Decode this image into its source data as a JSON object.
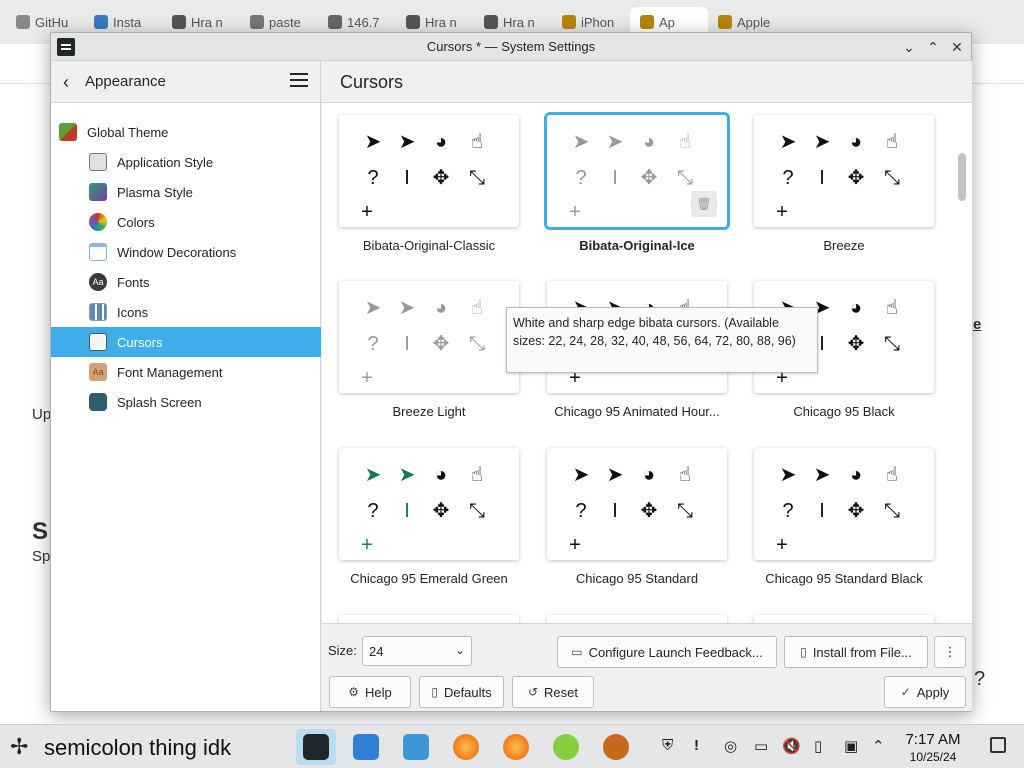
{
  "browser": {
    "tabs": [
      "GitHu",
      "Insta",
      "Hra n",
      "paste",
      "146.7",
      "Hra n",
      "Hra n",
      "iPhon",
      "Ap",
      "Apple"
    ],
    "bg_texts": [
      "Up",
      "S",
      "Sp",
      "e",
      "?"
    ]
  },
  "window": {
    "title": "Cursors * — System Settings",
    "minimize_glyph": "⌄",
    "maximize_glyph": "⌃",
    "close_glyph": "✕"
  },
  "sidebar": {
    "back_label": "Appearance",
    "back_glyph": "‹",
    "items": [
      {
        "label": "Global Theme",
        "icon": "global-theme-icon",
        "color": "#5a9e3a"
      },
      {
        "label": "Application Style",
        "icon": "application-style-icon",
        "color": "#6e7a82"
      },
      {
        "label": "Plasma Style",
        "icon": "plasma-style-icon",
        "color": "#7a3e8c"
      },
      {
        "label": "Colors",
        "icon": "colors-icon",
        "color": "#c0392b"
      },
      {
        "label": "Window Decorations",
        "icon": "window-decorations-icon",
        "color": "#8fb6d8"
      },
      {
        "label": "Fonts",
        "icon": "fonts-icon",
        "color": "#3a3a3a"
      },
      {
        "label": "Icons",
        "icon": "icons-icon",
        "color": "#5b8bb5"
      },
      {
        "label": "Cursors",
        "icon": "cursors-icon",
        "color": "#d9d9d9"
      },
      {
        "label": "Font Management",
        "icon": "font-management-icon",
        "color": "#d4a373"
      },
      {
        "label": "Splash Screen",
        "icon": "splash-screen-icon",
        "color": "#2d5f6f"
      }
    ]
  },
  "content": {
    "title": "Cursors",
    "themes": [
      {
        "name": "Bibata-Original-Classic",
        "style": "dark",
        "selected": false
      },
      {
        "name": "Bibata-Original-Ice",
        "style": "light",
        "selected": true
      },
      {
        "name": "Breeze",
        "style": "dark",
        "selected": false
      },
      {
        "name": "Breeze Light",
        "style": "light",
        "selected": false
      },
      {
        "name": "Chicago 95 Animated Hour...",
        "style": "dark",
        "selected": false
      },
      {
        "name": "Chicago 95 Black",
        "style": "dark",
        "selected": false
      },
      {
        "name": "Chicago 95 Emerald Green",
        "style": "green",
        "selected": false
      },
      {
        "name": "Chicago 95 Standard",
        "style": "dark",
        "selected": false
      },
      {
        "name": "Chicago 95 Standard Black",
        "style": "dark",
        "selected": false
      }
    ],
    "tooltip": "White and sharp edge bibata cursors. (Available sizes: 22, 24, 28, 32, 40, 48, 56, 64, 72, 80, 88, 96)",
    "cursor_glyphs": [
      "➤",
      "➤",
      "◕",
      "☝",
      "?",
      "I",
      "✥",
      "⤡",
      "+"
    ],
    "trash_glyph": "🗑"
  },
  "controls": {
    "size_label": "Size:",
    "size_value": "24",
    "size_chevron": "⌄",
    "configure_label": "Configure Launch Feedback...",
    "install_label": "Install from File...",
    "more_glyph": "⋮",
    "help_label": "Help",
    "defaults_label": "Defaults",
    "reset_label": "Reset",
    "apply_label": "Apply"
  },
  "taskbar": {
    "text": "semicolon thing idk",
    "spark_glyph": "✢",
    "time": "7:17 AM",
    "date": "10/25/24",
    "tray_glyphs": [
      "⛨",
      "!",
      "◎",
      "▭",
      "🔇",
      "▯",
      "▣",
      "⌃"
    ]
  },
  "colors": {
    "accent": "#3daee9",
    "window_bg": "#eff0f1",
    "selected_text": "#ffffff"
  }
}
